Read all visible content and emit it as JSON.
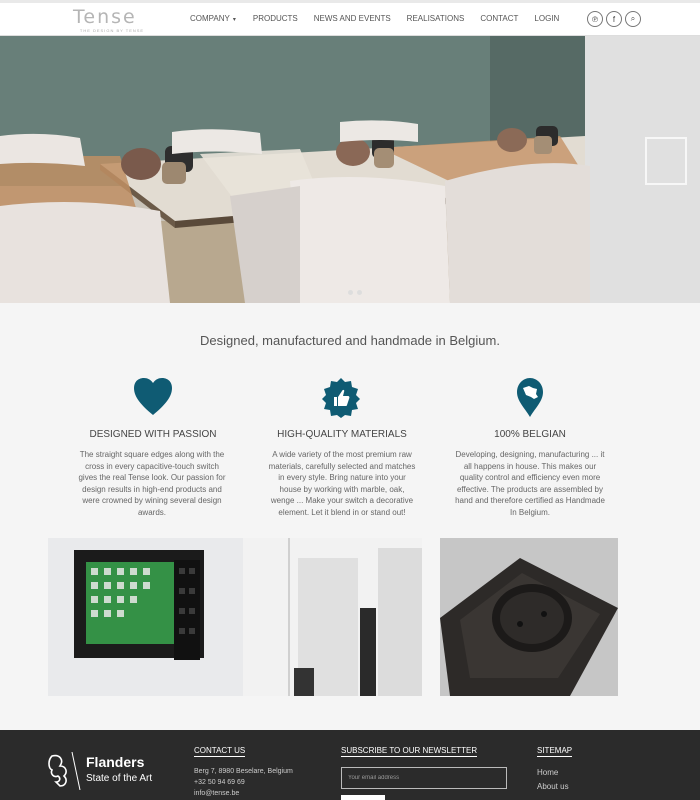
{
  "header": {
    "logo_text": "Tense",
    "logo_tagline": "THE DESIGN BY TENSE",
    "nav": [
      {
        "label": "COMPANY",
        "has_caret": true
      },
      {
        "label": "PRODUCTS"
      },
      {
        "label": "NEWS AND EVENTS"
      },
      {
        "label": "REALISATIONS"
      },
      {
        "label": "CONTACT"
      },
      {
        "label": "LOGIN"
      }
    ],
    "caret": "▾",
    "social_icons": [
      "pinterest-icon",
      "facebook-icon",
      "search-icon"
    ],
    "social_glyphs": [
      "℗",
      "f",
      "⌕"
    ]
  },
  "hero": {
    "slides": 2,
    "active_slide": 1
  },
  "intro": {
    "tagline": "Designed, manufactured and handmade in Belgium.",
    "accent_color": "#0f5b73",
    "features": [
      {
        "icon": "heart-icon",
        "title": "DESIGNED WITH PASSION",
        "text": "The straight square edges along with the cross in every capacitive-touch switch gives the real Tense look. Our passion for design results in high-end products and were crowned by wining several design awards."
      },
      {
        "icon": "thumbs-up-badge-icon",
        "title": "HIGH-QUALITY MATERIALS",
        "text": "A wide variety of the most premium raw materials, carefully selected and matches in every style. Bring nature into your house by working with marble, oak, wenge ... Make your switch a decorative element. Let it blend in or stand out!"
      },
      {
        "icon": "belgium-pin-icon",
        "title": "100% BELGIAN",
        "text": "Developing, designing, manufacturing ... it all happens in house. This makes our quality control and efficiency even more effective. The products are assembled by hand and therefore certified as Handmade In Belgium."
      }
    ]
  },
  "footer": {
    "flanders_line1": "Flanders",
    "flanders_line2": "State of the Art",
    "contact_title": "CONTACT US",
    "contact_lines": [
      "Berg 7, 8980 Beselare, Belgium",
      "+32 50 94 69 69",
      "info@tense.be"
    ],
    "newsletter_title": "SUBSCRIBE TO OUR NEWSLETTER",
    "email_placeholder": "Your email address",
    "sitemap_title": "SITEMAP",
    "sitemap_links": [
      "Home",
      "About us"
    ]
  }
}
